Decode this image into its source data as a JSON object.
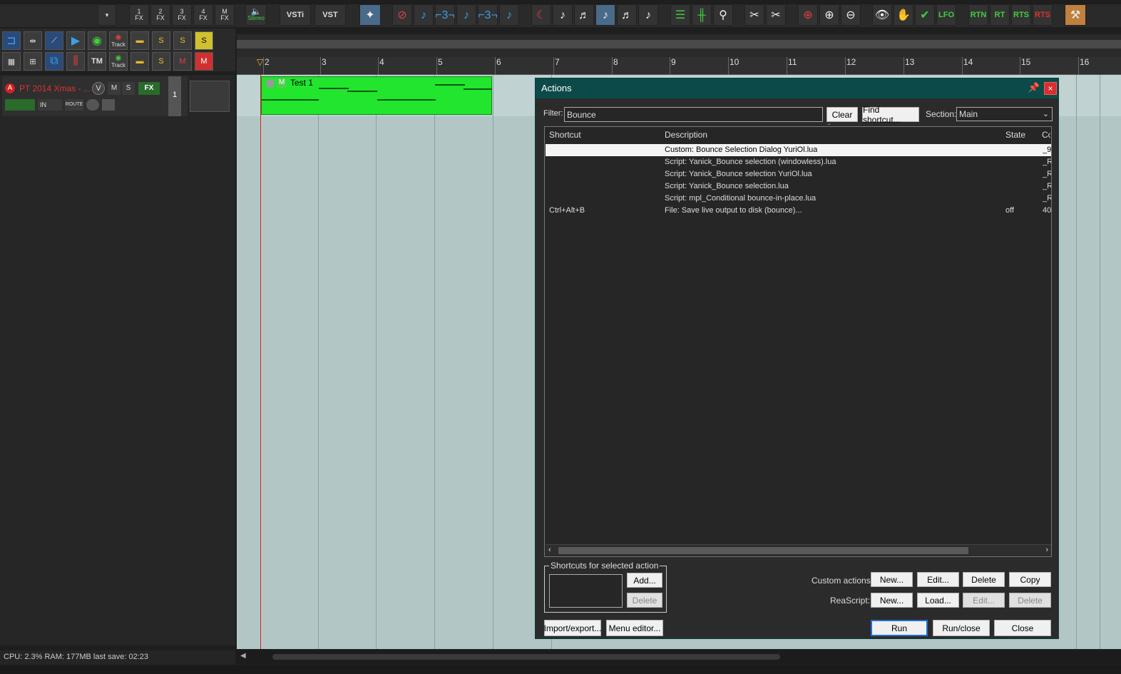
{
  "toolbar": {
    "fx_buttons": [
      "1\nFX",
      "2\nFX",
      "3\nFX",
      "4\nFX",
      "M\nFX"
    ],
    "stereo_label": "Stereo",
    "vsti_label": "VSTi",
    "vst_label": "VST",
    "lfo_label": "LFO",
    "rt_labels": [
      "RTN",
      "RT",
      "RTS",
      "RTS"
    ]
  },
  "left_toolbar": {
    "track_label_1": "Track",
    "track_label_2": "Track",
    "tm_label": "TM",
    "s_label": "S",
    "m_label": "M"
  },
  "track": {
    "name": "PT 2014 Xmas - ...1",
    "number": "1",
    "mute": "M",
    "solo": "S",
    "fx": "FX",
    "in": "IN",
    "route": "ROUTE",
    "v": "V"
  },
  "ruler": {
    "labels": [
      "2",
      "3",
      "4",
      "5",
      "6",
      "7",
      "8",
      "9",
      "10",
      "11",
      "12",
      "13",
      "14",
      "15",
      "16"
    ]
  },
  "item": {
    "name": "Test 1",
    "m": "M"
  },
  "status": {
    "text": "CPU: 2.3%  RAM: 177MB  last save: 02:23"
  },
  "actions": {
    "title": "Actions",
    "filter_label": "Filter:",
    "filter_value": "Bounce",
    "clear_btn": "Clear",
    "find_btn": "Find shortcut...",
    "section_label": "Section:",
    "section_value": "Main",
    "columns": [
      "Shortcut",
      "Description",
      "State",
      "Co"
    ],
    "rows": [
      {
        "shortcut": "",
        "desc": "Custom: Bounce Selection Dialog YuriOl.lua",
        "state": "",
        "cmd": "_9"
      },
      {
        "shortcut": "",
        "desc": "Script: Yanick_Bounce selection (windowless).lua",
        "state": "",
        "cmd": "_R"
      },
      {
        "shortcut": "",
        "desc": "Script: Yanick_Bounce selection YuriOl.lua",
        "state": "",
        "cmd": "_R"
      },
      {
        "shortcut": "",
        "desc": "Script: Yanick_Bounce selection.lua",
        "state": "",
        "cmd": "_R"
      },
      {
        "shortcut": "",
        "desc": "Script: mpl_Conditional bounce-in-place.lua",
        "state": "",
        "cmd": "_R"
      },
      {
        "shortcut": "Ctrl+Alt+B",
        "desc": "File: Save live output to disk (bounce)...",
        "state": "off",
        "cmd": "40"
      }
    ],
    "shortcuts_group": "Shortcuts for selected action",
    "add_btn": "Add...",
    "delete_btn": "Delete",
    "custom_actions_label": "Custom actions:",
    "ca_new": "New...",
    "ca_edit": "Edit...",
    "ca_delete": "Delete",
    "ca_copy": "Copy",
    "reascript_label": "ReaScript:",
    "rs_new": "New...",
    "rs_load": "Load...",
    "rs_edit": "Edit...",
    "rs_delete": "Delete",
    "import_btn": "Import/export...",
    "menu_btn": "Menu editor...",
    "run_btn": "Run",
    "runclose_btn": "Run/close",
    "close_btn": "Close"
  }
}
